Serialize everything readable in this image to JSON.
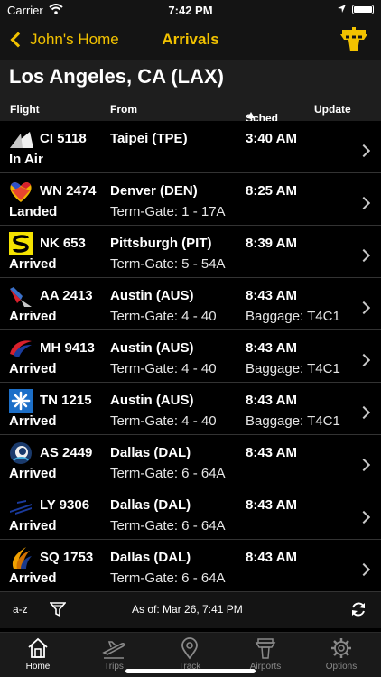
{
  "status_bar": {
    "carrier": "Carrier",
    "time": "7:42 PM"
  },
  "nav": {
    "back_label": "John's Home",
    "title": "Arrivals"
  },
  "airport": {
    "name": "Los Angeles, CA (LAX)"
  },
  "columns": {
    "flight": "Flight",
    "from": "From",
    "sched": "Sched",
    "update": "Update"
  },
  "flights": [
    {
      "number": "CI 5118",
      "status": "In Air",
      "origin": "Taipei (TPE)",
      "gate": "",
      "sched": "3:40 AM",
      "update": "",
      "logo": "china-airlines-logo"
    },
    {
      "number": "WN 2474",
      "status": "Landed",
      "origin": "Denver (DEN)",
      "gate": "Term-Gate: 1 - 17A",
      "sched": "8:25 AM",
      "update": "",
      "logo": "southwest-logo"
    },
    {
      "number": "NK 653",
      "status": "Arrived",
      "origin": "Pittsburgh (PIT)",
      "gate": "Term-Gate: 5 - 54A",
      "sched": "8:39 AM",
      "update": "",
      "logo": "spirit-logo"
    },
    {
      "number": "AA 2413",
      "status": "Arrived",
      "origin": "Austin (AUS)",
      "gate": "Term-Gate: 4 - 40",
      "sched": "8:43 AM",
      "update": "Baggage: T4C1",
      "logo": "american-logo"
    },
    {
      "number": "MH 9413",
      "status": "Arrived",
      "origin": "Austin (AUS)",
      "gate": "Term-Gate: 4 - 40",
      "sched": "8:43 AM",
      "update": "Baggage: T4C1",
      "logo": "malaysia-logo"
    },
    {
      "number": "TN 1215",
      "status": "Arrived",
      "origin": "Austin (AUS)",
      "gate": "Term-Gate: 4 - 40",
      "sched": "8:43 AM",
      "update": "Baggage: T4C1",
      "logo": "air-tahiti-logo"
    },
    {
      "number": "AS 2449",
      "status": "Arrived",
      "origin": "Dallas (DAL)",
      "gate": "Term-Gate: 6 - 64A",
      "sched": "8:43 AM",
      "update": "",
      "logo": "alaska-logo"
    },
    {
      "number": "LY 9306",
      "status": "Arrived",
      "origin": "Dallas (DAL)",
      "gate": "Term-Gate: 6 - 64A",
      "sched": "8:43 AM",
      "update": "",
      "logo": "el-al-logo"
    },
    {
      "number": "SQ 1753",
      "status": "Arrived",
      "origin": "Dallas (DAL)",
      "gate": "Term-Gate: 6 - 64A",
      "sched": "8:43 AM",
      "update": "",
      "logo": "singapore-logo"
    }
  ],
  "info_bar": {
    "sort_label": "a-z",
    "as_of": "As of: Mar 26, 7:41 PM"
  },
  "tabs": [
    {
      "label": "Home",
      "icon": "home-icon",
      "active": true
    },
    {
      "label": "Trips",
      "icon": "plane-icon",
      "active": false
    },
    {
      "label": "Track",
      "icon": "location-pin-icon",
      "active": false
    },
    {
      "label": "Airports",
      "icon": "control-tower-icon",
      "active": false
    },
    {
      "label": "Options",
      "icon": "gear-icon",
      "active": false
    }
  ],
  "colors": {
    "accent": "#f2c200",
    "background": "#000000",
    "header": "#1e1e1e"
  }
}
